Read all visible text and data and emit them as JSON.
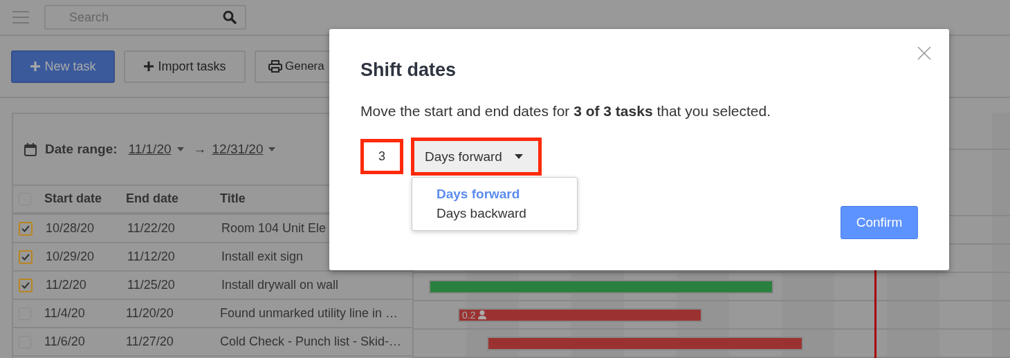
{
  "top_bar": {
    "search": {
      "placeholder": "Search"
    }
  },
  "toolbar": [
    {
      "label": "New task",
      "kind": "primary"
    },
    {
      "label": "Import tasks",
      "kind": "add"
    },
    {
      "label": "Genera",
      "kind": "print"
    }
  ],
  "date_range": {
    "label": "Date range:",
    "start": "11/1/20",
    "arrow": "→",
    "end": "12/31/20"
  },
  "table": {
    "columns": [
      "Start date",
      "End date",
      "Title"
    ],
    "header_checked": false,
    "rows": [
      {
        "checked": true,
        "start": "10/28/20",
        "end": "11/22/20",
        "title": "Room 104 Unit Ele"
      },
      {
        "checked": true,
        "start": "10/29/20",
        "end": "11/12/20",
        "title": "Install exit sign"
      },
      {
        "checked": true,
        "start": "11/2/20",
        "end": "11/25/20",
        "title": "Install drywall on wall",
        "bar": {
          "color": "#2a803e"
        }
      },
      {
        "checked": false,
        "start": "11/4/20",
        "end": "11/20/20",
        "title": "Found unmarked utility line in …",
        "bar": {
          "color": "#9b3232",
          "label": "0.2"
        }
      },
      {
        "checked": false,
        "start": "11/6/20",
        "end": "11/27/20",
        "title": "Cold Check - Punch list - Skid-…",
        "bar": {
          "color": "#9b3232"
        }
      }
    ]
  },
  "modal": {
    "title": "Shift dates",
    "message": "Move the start and end dates for **3 of 3 tasks** that you selected.",
    "amount": "3",
    "unit": "Days forward",
    "options": [
      {
        "label": "Days forward",
        "selected": true
      },
      {
        "label": "Days backward",
        "selected": false
      }
    ],
    "confirm": "Confirm"
  }
}
